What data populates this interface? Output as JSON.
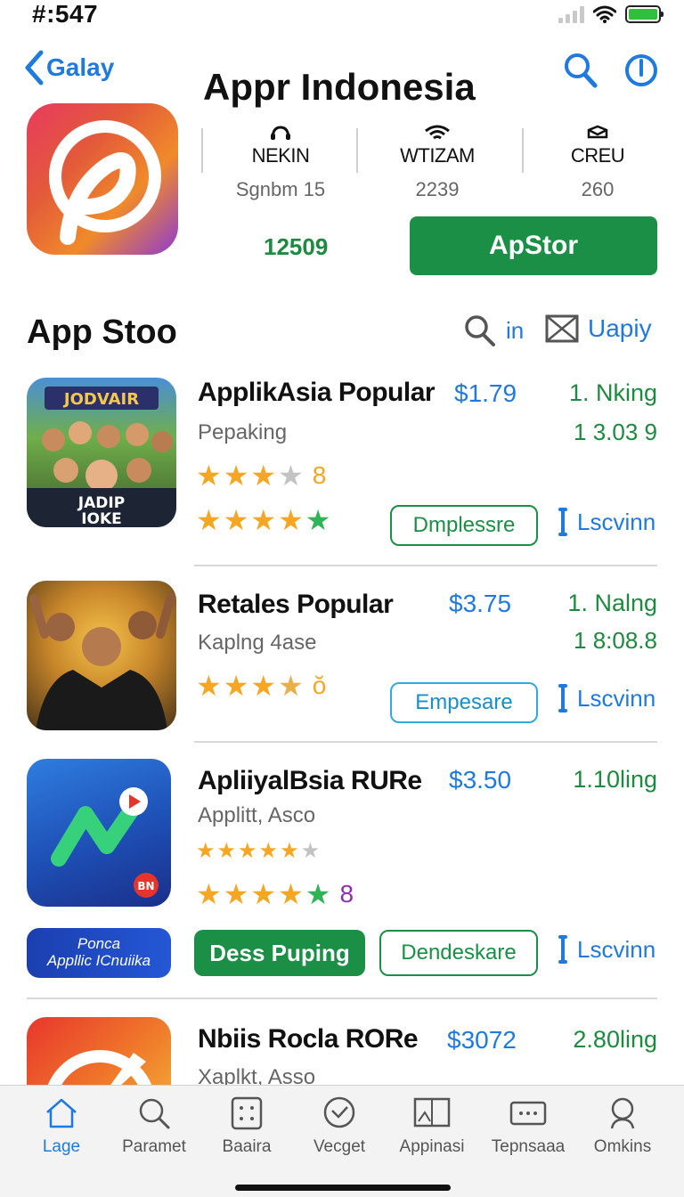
{
  "status_bar": {
    "time": "#:547"
  },
  "header": {
    "back_label": "Galay",
    "title": "Appr Indonesia"
  },
  "hero": {
    "stats": [
      {
        "key": "NEKIN",
        "value": "Sgnbm 15"
      },
      {
        "key": "WTIZAM",
        "value": "2239"
      },
      {
        "key": "CREU",
        "value": "260"
      }
    ],
    "count": "12509",
    "get_button": "ApStor"
  },
  "section": {
    "title": "App Stoo",
    "search_label": "in",
    "update_label": "Uapiy"
  },
  "apps": [
    {
      "name": "ApplikAsia Popular",
      "price": "$1.79",
      "rank": "1. Nking",
      "subtitle": "Pepaking",
      "rank_detail": "1 3.03 9",
      "rating1": "8",
      "thumb_text1": "JODVAIR",
      "thumb_text2": "JADIP",
      "thumb_text3": "IOKE",
      "action_button": "Dmplessre",
      "link_label": "Lscvinn"
    },
    {
      "name": "Retales Popular",
      "price": "$3.75",
      "rank": "1. Nalng",
      "subtitle": "Kaplng 4ase",
      "rank_detail": "1 8:08.8",
      "rating1": "ŏ",
      "action_button": "Empesare",
      "link_label": "Lscvinn"
    },
    {
      "name": "ApliiyalBsia RURe",
      "price": "$3.50",
      "rank": "1.10ling",
      "subtitle": "Applitt, Asco",
      "rating2": "8",
      "thumb_badge": "BN",
      "pill_line1": "Ponca",
      "pill_line2": "Appllic ICnuiika",
      "primary_button": "Dess Puping",
      "action_button": "Dendeskare",
      "link_label": "Lscvinn"
    },
    {
      "name": "Nbiis Rocla RORe",
      "price": "$3072",
      "rank": "2.80ling",
      "subtitle": "Xaplkt, Asso"
    }
  ],
  "tabs": [
    {
      "label": "Lage"
    },
    {
      "label": "Paramet"
    },
    {
      "label": "Baaira"
    },
    {
      "label": "Vecget"
    },
    {
      "label": "Appinasi"
    },
    {
      "label": "Tepnsaaa"
    },
    {
      "label": "Omkins"
    }
  ],
  "colors": {
    "accent_blue": "#1f7ae0",
    "accent_green": "#1b8f46",
    "star": "#f5a623"
  }
}
